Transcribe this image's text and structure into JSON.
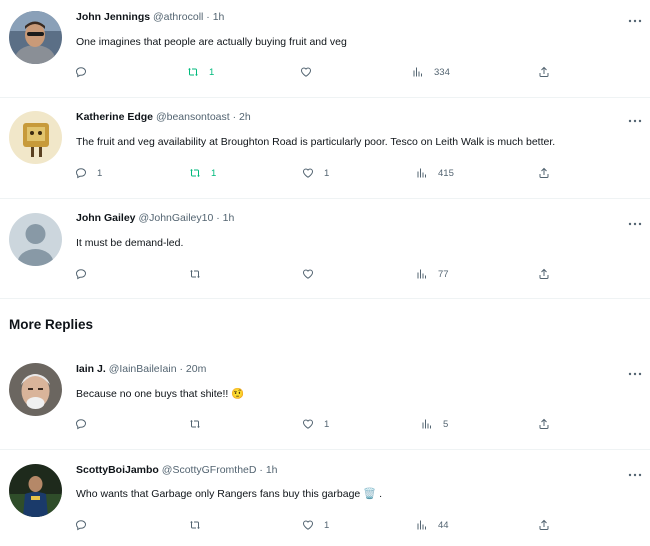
{
  "tweets": [
    {
      "name": "John Jennings",
      "handle": "@athrocoll",
      "sep": "·",
      "time": "1h",
      "text": "One imagines that people are actually buying fruit and veg",
      "reply_count": "",
      "retweet_count": "1",
      "like_count": "",
      "views": "334",
      "retweet_active": true
    },
    {
      "name": "Katherine Edge",
      "handle": "@beansontoast",
      "sep": "·",
      "time": "2h",
      "text": "The fruit and veg availability at Broughton Road is particularly poor. Tesco on Leith Walk is much better.",
      "reply_count": "1",
      "retweet_count": "1",
      "like_count": "1",
      "views": "415",
      "retweet_active": true
    },
    {
      "name": "John Gailey",
      "handle": "@JohnGailey10",
      "sep": "·",
      "time": "1h",
      "text": "It must be demand-led.",
      "reply_count": "",
      "retweet_count": "",
      "like_count": "",
      "views": "77",
      "retweet_active": false
    }
  ],
  "more_replies": {
    "title": "More Replies",
    "tweets": [
      {
        "name": "Iain J.",
        "handle": "@IainBaileIain",
        "sep": "·",
        "time": "20m",
        "text": "Because no one buys that shite!! 🤨",
        "reply_count": "",
        "retweet_count": "",
        "like_count": "1",
        "views": "5",
        "retweet_active": false
      },
      {
        "name": "ScottyBoiJambo",
        "handle": "@ScottyGFromtheD",
        "sep": "·",
        "time": "1h",
        "text": "Who wants that Garbage only Rangers fans buy this garbage 🗑️ .",
        "reply_count": "",
        "retweet_count": "",
        "like_count": "1",
        "views": "44",
        "retweet_active": false
      }
    ]
  },
  "colors": {
    "accent_retweet": "#00ba7c",
    "secondary_text": "#536471",
    "divider": "#eff3f4"
  },
  "icons": [
    "reply-icon",
    "retweet-icon",
    "like-icon",
    "views-icon",
    "share-icon",
    "more-icon"
  ]
}
